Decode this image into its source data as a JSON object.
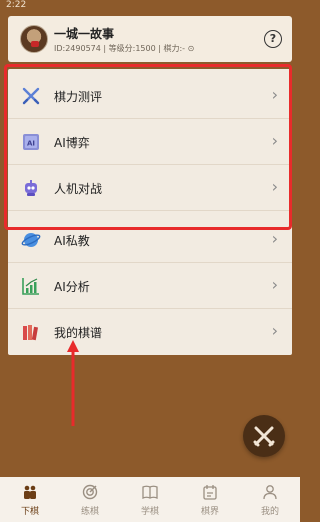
{
  "status_bar": {
    "time": "2:22",
    "signal": ""
  },
  "profile": {
    "name": "一城一故事",
    "meta": "ID:2490574 | 等级分:1500 | 棋力:- ⊙",
    "help_label": "?"
  },
  "menu": {
    "items": [
      {
        "label": "棋力测评",
        "icon": "crossed-swords-icon"
      },
      {
        "label": "AI博弈",
        "icon": "ai-chip-icon"
      },
      {
        "label": "人机对战",
        "icon": "robot-icon"
      },
      {
        "label": "AI私教",
        "icon": "planet-icon"
      },
      {
        "label": "AI分析",
        "icon": "bar-chart-icon"
      },
      {
        "label": "我的棋谱",
        "icon": "books-icon"
      }
    ],
    "chevron": "›"
  },
  "tabs": [
    {
      "label": "下棋",
      "icon": "players-icon",
      "active": true
    },
    {
      "label": "练棋",
      "icon": "target-icon",
      "active": false
    },
    {
      "label": "学棋",
      "icon": "book-icon",
      "active": false
    },
    {
      "label": "棋界",
      "icon": "calendar-icon",
      "active": false
    },
    {
      "label": "我的",
      "icon": "person-icon",
      "active": false
    }
  ],
  "colors": {
    "background": "#8d5a2b",
    "highlight": "#e82b2b",
    "accent": "#6b3e16"
  }
}
